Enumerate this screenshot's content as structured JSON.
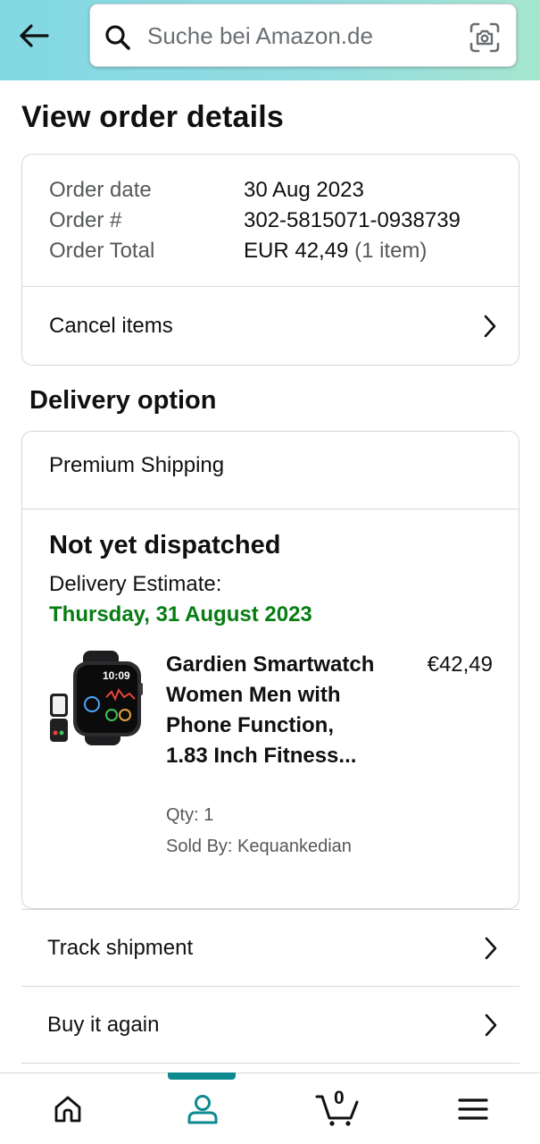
{
  "header": {
    "search_placeholder": "Suche bei Amazon.de"
  },
  "page": {
    "title": "View order details"
  },
  "order": {
    "rows": [
      {
        "label": "Order date",
        "value": "30 Aug 2023",
        "extra": ""
      },
      {
        "label": "Order #",
        "value": "302-5815071-0938739",
        "extra": ""
      },
      {
        "label": "Order Total",
        "value": "EUR 42,49",
        "extra": "(1 item)"
      }
    ],
    "cancel_label": "Cancel items"
  },
  "delivery": {
    "heading": "Delivery option",
    "shipping": "Premium Shipping",
    "status": "Not yet dispatched",
    "estimate_label": "Delivery Estimate:",
    "estimate_date": "Thursday, 31 August 2023",
    "estimate_color": "#067d12",
    "product": {
      "title": "Gardien Smartwatch Women Men with Phone Function, 1.83 Inch Fitness...",
      "price": "€42,49",
      "qty": "Qty: 1",
      "seller": "Sold By: Kequankedian",
      "image_time": "10:09"
    }
  },
  "actions": {
    "track": "Track shipment",
    "buy_again": "Buy it again"
  },
  "bottom_nav": {
    "items": [
      "home-icon",
      "account-icon",
      "cart-icon",
      "menu-icon"
    ],
    "active": "account-icon",
    "cart_count": "0",
    "accent": "#0f8a8f"
  }
}
